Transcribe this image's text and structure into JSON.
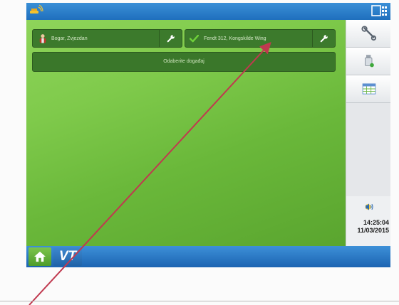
{
  "operator": {
    "name": "Bogar, Zvjezdan"
  },
  "equipment": {
    "name": "Fendt 312, Kongskilde Wing"
  },
  "event": {
    "label": "Odaberite događaj"
  },
  "status_bar": {
    "time": "14:25:04",
    "date": "11/03/2015"
  },
  "bottom_bar": {
    "vt_label": "VT"
  },
  "icons": {
    "gps": "gps-satellite-icon",
    "screen_switch": "screen-switch-icon",
    "operator": "operator-person-icon",
    "operator_settings": "wrench-icon",
    "equipment_check": "checkmark-icon",
    "equipment_settings": "wrench-icon",
    "side_tools": "wrench-tools-icon",
    "side_usb": "usb-drive-icon",
    "side_table": "table-grid-icon",
    "side_volume": "volume-icon",
    "home": "home-icon"
  },
  "colors": {
    "field_green": "#7fca4b",
    "panel_green": "#3c7a2c",
    "bar_blue": "#1f6fbd",
    "check_green": "#6fd13a",
    "annotation_arrow": "#c0394f"
  }
}
